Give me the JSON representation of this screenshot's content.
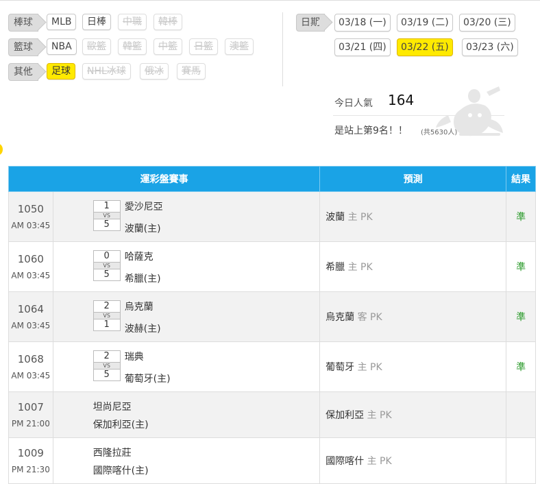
{
  "categories": [
    {
      "label": "棒球",
      "items": [
        {
          "text": "MLB",
          "state": "normal"
        },
        {
          "text": "日棒",
          "state": "normal"
        },
        {
          "text": "中職",
          "state": "disabled"
        },
        {
          "text": "韓棒",
          "state": "disabled"
        }
      ]
    },
    {
      "label": "籃球",
      "items": [
        {
          "text": "NBA",
          "state": "normal"
        },
        {
          "text": "歐籃",
          "state": "disabled"
        },
        {
          "text": "韓籃",
          "state": "disabled"
        },
        {
          "text": "中籃",
          "state": "disabled"
        },
        {
          "text": "日籃",
          "state": "disabled"
        },
        {
          "text": "澳籃",
          "state": "disabled"
        }
      ]
    },
    {
      "label": "其他",
      "items": [
        {
          "text": "足球",
          "state": "active"
        },
        {
          "text": "NHL冰球",
          "state": "disabled"
        },
        {
          "text": "俄冰",
          "state": "disabled"
        },
        {
          "text": "賽馬",
          "state": "disabled"
        }
      ]
    }
  ],
  "date": {
    "label": "日期",
    "items": [
      {
        "text": "03/18 (一)",
        "active": false
      },
      {
        "text": "03/19 (二)",
        "active": false
      },
      {
        "text": "03/20 (三)",
        "active": false
      },
      {
        "text": "03/21 (四)",
        "active": false
      },
      {
        "text": "03/22 (五)",
        "active": true
      },
      {
        "text": "03/23 (六)",
        "active": false
      }
    ]
  },
  "stats": {
    "popularity_label": "今日人氣",
    "popularity_value": "164",
    "rank_text": "是站上第9名！！",
    "rank_total": "(共5630人)"
  },
  "table": {
    "headers": {
      "event": "運彩盤賽事",
      "prediction": "預測",
      "result": "結果"
    },
    "rows": [
      {
        "no": "1050",
        "time": "AM 03:45",
        "away": "愛沙尼亞",
        "home": "波蘭(主)",
        "away_score": "1",
        "home_score": "5",
        "vs": "VS",
        "pick": "波蘭",
        "pick_type": "主 PK",
        "result": "準"
      },
      {
        "no": "1060",
        "time": "AM 03:45",
        "away": "哈薩克",
        "home": "希臘(主)",
        "away_score": "0",
        "home_score": "5",
        "vs": "VS",
        "pick": "希臘",
        "pick_type": "主 PK",
        "result": "準"
      },
      {
        "no": "1064",
        "time": "AM 03:45",
        "away": "烏克蘭",
        "home": "波赫(主)",
        "away_score": "2",
        "home_score": "1",
        "vs": "VS",
        "pick": "烏克蘭",
        "pick_type": "客 PK",
        "result": "準"
      },
      {
        "no": "1068",
        "time": "AM 03:45",
        "away": "瑞典",
        "home": "葡萄牙(主)",
        "away_score": "2",
        "home_score": "5",
        "vs": "VS",
        "pick": "葡萄牙",
        "pick_type": "主 PK",
        "result": "準"
      },
      {
        "no": "1007",
        "time": "PM 21:00",
        "away": "坦尚尼亞",
        "home": "保加利亞(主)",
        "away_score": null,
        "home_score": null,
        "vs": null,
        "pick": "保加利亞",
        "pick_type": "主 PK",
        "result": ""
      },
      {
        "no": "1009",
        "time": "PM 21:30",
        "away": "西隆拉莊",
        "home": "國際喀什(主)",
        "away_score": null,
        "home_score": null,
        "vs": null,
        "pick": "國際喀什",
        "pick_type": "主 PK",
        "result": ""
      }
    ]
  },
  "colors": {
    "header_blue": "#1aa3e6",
    "active_yellow": "#ffea00",
    "result_green": "#2a9a2a"
  }
}
